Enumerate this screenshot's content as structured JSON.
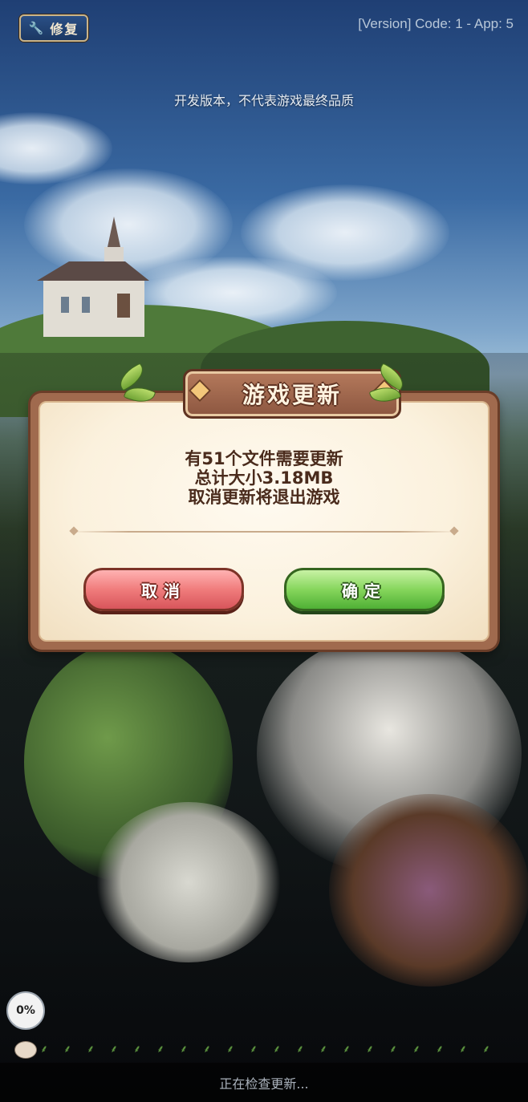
{
  "header": {
    "repair_label": "修复",
    "repair_icon": "wrench-icon",
    "version_text": "[Version] Code: 1 - App: 5",
    "dev_notice": "开发版本，不代表游戏最终品质"
  },
  "dialog": {
    "title": "游戏更新",
    "message_lines": [
      "有51个文件需要更新",
      "总计大小3.18MB",
      "取消更新将退出游戏"
    ],
    "cancel_label": "取消",
    "confirm_label": "确定"
  },
  "progress": {
    "percent_text": "0%",
    "percent_value": 0,
    "status_text": "正在检查更新...",
    "seed_icon": "sprout-icon"
  },
  "colors": {
    "dialog_border": "#a06a4e",
    "cancel_button": "#f07c7c",
    "confirm_button": "#86d65c",
    "message_text": "#4a2b1c"
  }
}
